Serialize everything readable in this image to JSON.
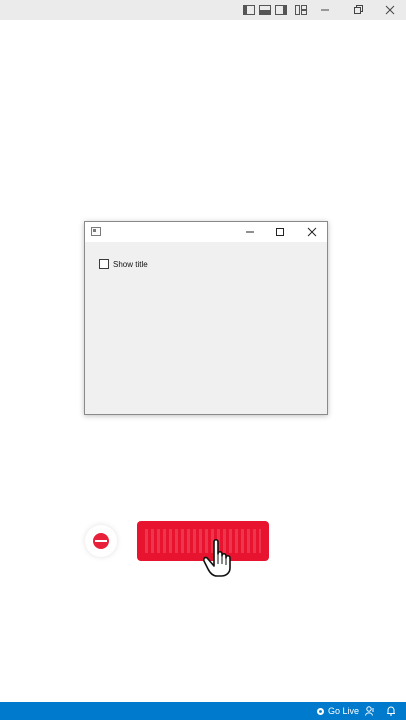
{
  "topbar": {
    "icons": [
      "layout-sidebar-left-icon",
      "layout-panel-icon",
      "layout-sidebar-right-icon",
      "customize-layout-icon"
    ],
    "window_controls": [
      "minimize-icon",
      "restore-icon",
      "close-icon"
    ]
  },
  "dialog": {
    "title": "",
    "checkbox_label": "Show title",
    "checkbox_checked": false
  },
  "overlay": {
    "subscribe_color": "#e8132e"
  },
  "statusbar": {
    "go_live_label": "Go Live",
    "accent_color": "#007acc"
  }
}
